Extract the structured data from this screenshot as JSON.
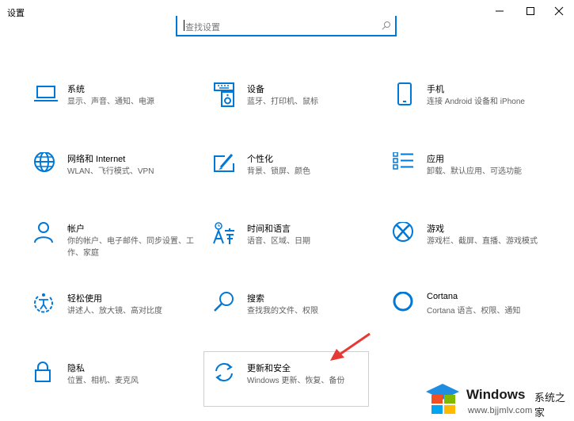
{
  "window": {
    "title": "设置"
  },
  "search": {
    "placeholder": "查找设置"
  },
  "accent": "#0078d7",
  "tiles": [
    {
      "name": "系统",
      "desc": "显示、声音、通知、电源",
      "icon": "laptop-icon"
    },
    {
      "name": "设备",
      "desc": "蓝牙、打印机、鼠标",
      "icon": "keyboard-speaker-icon"
    },
    {
      "name": "手机",
      "desc": "连接 Android 设备和 iPhone",
      "icon": "phone-icon"
    },
    {
      "name": "网络和 Internet",
      "desc": "WLAN、飞行模式、VPN",
      "icon": "globe-icon"
    },
    {
      "name": "个性化",
      "desc": "背景、锁屏、颜色",
      "icon": "paintbrush-icon"
    },
    {
      "name": "应用",
      "desc": "卸载、默认应用、可选功能",
      "icon": "app-list-icon"
    },
    {
      "name": "帐户",
      "desc": "你的帐户、电子邮件、同步设置、工作、家庭",
      "icon": "person-icon"
    },
    {
      "name": "时间和语言",
      "desc": "语音、区域、日期",
      "icon": "time-language-icon"
    },
    {
      "name": "游戏",
      "desc": "游戏栏、截屏、直播、游戏模式",
      "icon": "xbox-icon"
    },
    {
      "name": "轻松使用",
      "desc": "讲述人、放大镜、高对比度",
      "icon": "ease-of-access-icon"
    },
    {
      "name": "搜索",
      "desc": "查找我的文件、权限",
      "icon": "search-icon"
    },
    {
      "name": "Cortana",
      "desc": "Cortana 语言、权限、通知",
      "icon": "cortana-icon"
    },
    {
      "name": "隐私",
      "desc": "位置、相机、麦克风",
      "icon": "lock-icon"
    },
    {
      "name": "更新和安全",
      "desc": "Windows 更新、恢复、备份",
      "icon": "sync-icon"
    }
  ],
  "watermark": {
    "brand": "Windows",
    "cn": "系统之家",
    "url": "www.bjjmlv.com"
  },
  "annotation_arrow_color": "#e53935"
}
